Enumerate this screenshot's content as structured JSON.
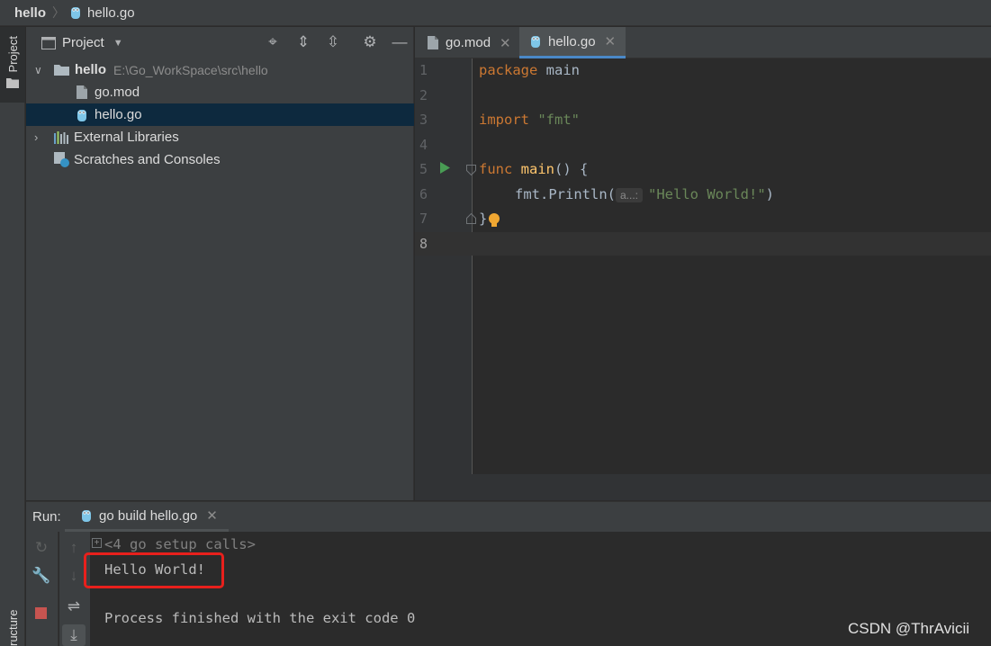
{
  "breadcrumb": {
    "root": "hello",
    "file": "hello.go"
  },
  "left_strip": {
    "project_tab": "Project",
    "structure_tab": "ructure"
  },
  "project_panel": {
    "title": "Project",
    "tree": {
      "root_name": "hello",
      "root_path": "E:\\Go_WorkSpace\\src\\hello",
      "files": [
        "go.mod",
        "hello.go"
      ],
      "external_libraries": "External Libraries",
      "scratches": "Scratches and Consoles"
    }
  },
  "editor": {
    "tabs": [
      {
        "label": "go.mod"
      },
      {
        "label": "hello.go"
      }
    ],
    "line_numbers": [
      "1",
      "2",
      "3",
      "4",
      "5",
      "6",
      "7",
      "8"
    ],
    "code": {
      "l1_kw": "package",
      "l1_rest": " main",
      "l3_kw": "import",
      "l3_str": "\"fmt\"",
      "l5_kw": "func",
      "l5_fn": "main",
      "l5_rest": "() {",
      "l6_call": "fmt.Println(",
      "l6_hint": "a...:",
      "l6_str": "\"Hello World!\"",
      "l6_close": ")",
      "l7": "}"
    }
  },
  "run_panel": {
    "label": "Run:",
    "tab_label": "go build hello.go",
    "console": {
      "setup_calls": "<4 go setup calls>",
      "output": "Hello World!",
      "process": "Process finished with the exit code 0"
    }
  },
  "watermark": "CSDN @ThrAvicii",
  "colors": {
    "keyword": "#cc7832",
    "function": "#ffc66d",
    "string": "#6a8759",
    "highlight_box": "#e8201c",
    "selection": "#0d293e"
  }
}
